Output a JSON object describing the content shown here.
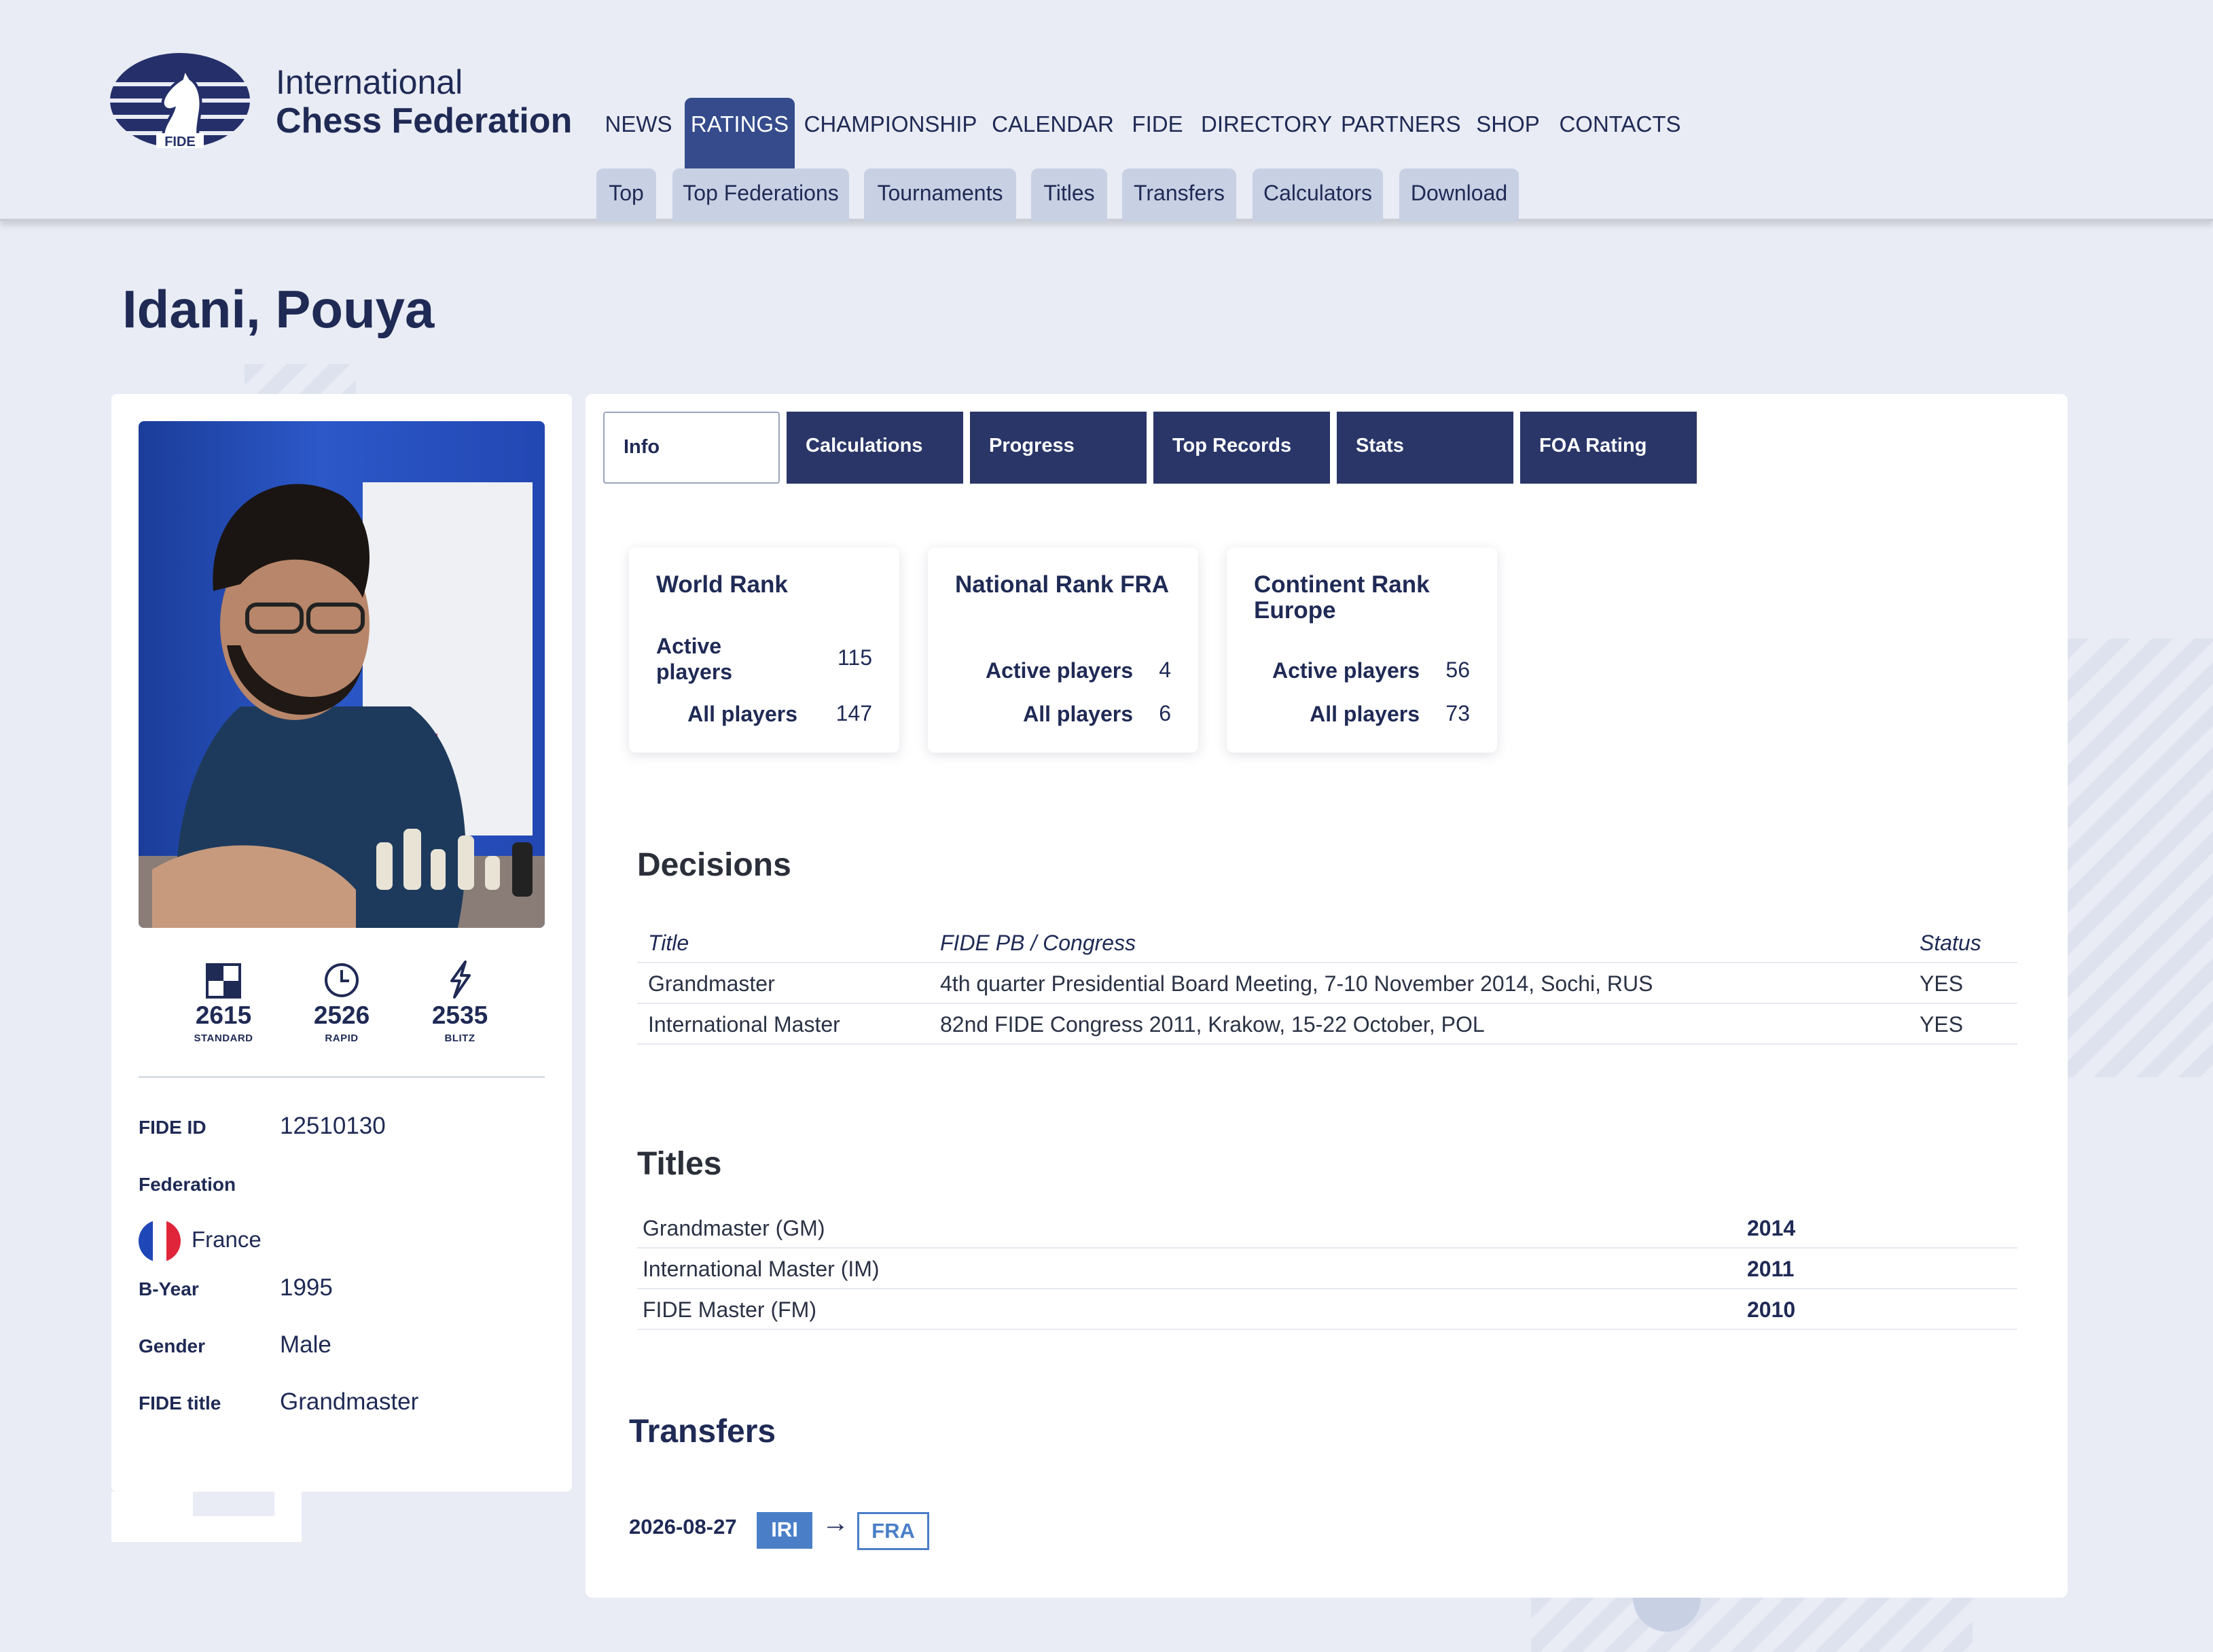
{
  "brand": {
    "logo_text": "FIDE",
    "line1": "International",
    "line2": "Chess Federation"
  },
  "nav": {
    "main": [
      "NEWS",
      "RATINGS",
      "CHAMPIONSHIP",
      "CALENDAR",
      "FIDE",
      "DIRECTORY",
      "PARTNERS",
      "SHOP",
      "CONTACTS"
    ],
    "active": "RATINGS",
    "sub": [
      "Top",
      "Top Federations",
      "Tournaments",
      "Titles",
      "Transfers",
      "Calculators",
      "Download"
    ]
  },
  "player": {
    "name": "Idani, Pouya",
    "ratings": [
      {
        "value": "2615",
        "label": "STANDARD",
        "icon": "chessboard-icon"
      },
      {
        "value": "2526",
        "label": "RAPID",
        "icon": "clock-icon"
      },
      {
        "value": "2535",
        "label": "BLITZ",
        "icon": "lightning-icon"
      }
    ],
    "fields": {
      "fide_id_label": "FIDE ID",
      "fide_id": "12510130",
      "federation_label": "Federation",
      "federation": "France",
      "byear_label": "B-Year",
      "byear": "1995",
      "gender_label": "Gender",
      "gender": "Male",
      "title_label": "FIDE title",
      "title": "Grandmaster"
    }
  },
  "tabs": [
    "Info",
    "Calculations",
    "Progress",
    "Top Records",
    "Stats",
    "FOA Rating"
  ],
  "active_tab": "Info",
  "ranks": [
    {
      "title": "World Rank",
      "active_label": "Active players",
      "active": "115",
      "all_label": "All players",
      "all": "147"
    },
    {
      "title": "National Rank FRA",
      "active_label": "Active players",
      "active": "4",
      "all_label": "All players",
      "all": "6"
    },
    {
      "title": "Continent Rank Europe",
      "active_label": "Active players",
      "active": "56",
      "all_label": "All players",
      "all": "73"
    }
  ],
  "decisions": {
    "heading": "Decisions",
    "columns": [
      "Title",
      "FIDE PB / Congress",
      "Status"
    ],
    "rows": [
      [
        "Grandmaster",
        "4th quarter Presidential Board Meeting, 7-10 November 2014, Sochi, RUS",
        "YES"
      ],
      [
        "International Master",
        "82nd FIDE Congress 2011, Krakow, 15-22 October, POL",
        "YES"
      ]
    ]
  },
  "titles": {
    "heading": "Titles",
    "rows": [
      [
        "Grandmaster (GM)",
        "2014"
      ],
      [
        "International Master (IM)",
        "2011"
      ],
      [
        "FIDE Master (FM)",
        "2010"
      ]
    ]
  },
  "transfers": {
    "heading": "Transfers",
    "items": [
      {
        "date": "2026-08-27",
        "from": "IRI",
        "to": "FRA"
      }
    ]
  },
  "colors": {
    "background": "#e9ecf4",
    "navy": "#1f2a55",
    "active_nav": "#354b8c",
    "tab_dark": "#2a3668",
    "subnav": "#c8d0e4",
    "fed_blue": "#4a7fc8"
  }
}
